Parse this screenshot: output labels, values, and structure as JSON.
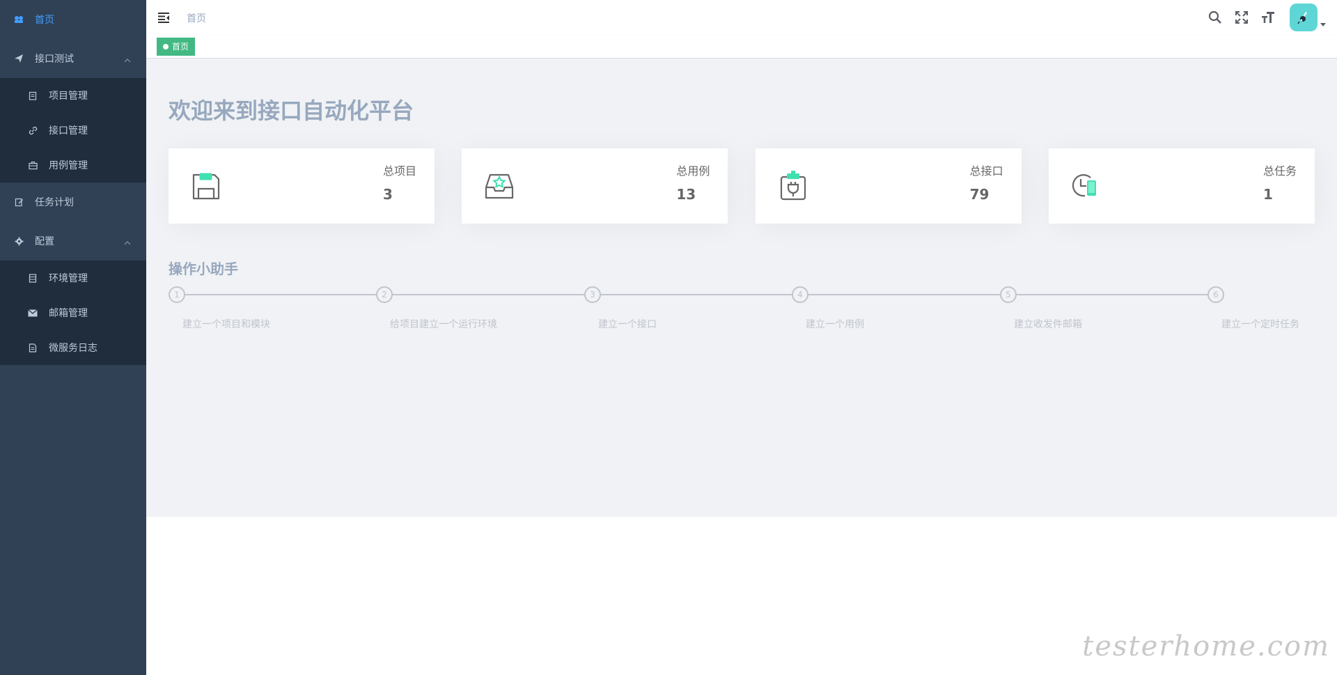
{
  "sidebar": {
    "items": [
      {
        "label": "首页",
        "icon": "dashboard-icon",
        "active": true
      },
      {
        "label": "接口测试",
        "icon": "send-icon",
        "expanded": true,
        "children": [
          {
            "label": "项目管理",
            "icon": "clipboard-icon"
          },
          {
            "label": "接口管理",
            "icon": "link-icon"
          },
          {
            "label": "用例管理",
            "icon": "briefcase-icon"
          }
        ]
      },
      {
        "label": "任务计划",
        "icon": "edit-icon"
      },
      {
        "label": "配置",
        "icon": "gear-icon",
        "expanded": true,
        "children": [
          {
            "label": "环境管理",
            "icon": "list-icon"
          },
          {
            "label": "邮箱管理",
            "icon": "envelope-icon"
          },
          {
            "label": "微服务日志",
            "icon": "document-icon"
          }
        ]
      }
    ]
  },
  "navbar": {
    "breadcrumb": "首页",
    "icons": [
      "search-icon",
      "fullscreen-icon",
      "font-size-icon"
    ],
    "avatar_color": "#5fd6d6"
  },
  "tags_view": {
    "active_tag": "首页",
    "active_color": "#42b983"
  },
  "main": {
    "welcome": "欢迎来到接口自动化平台",
    "cards": [
      {
        "label": "总项目",
        "value": "3",
        "icon": "save-disk-icon"
      },
      {
        "label": "总用例",
        "value": "13",
        "icon": "inbox-star-icon"
      },
      {
        "label": "总接口",
        "value": "79",
        "icon": "plug-icon"
      },
      {
        "label": "总任务",
        "value": "1",
        "icon": "clock-phone-icon"
      }
    ],
    "helper_title": "操作小助手",
    "steps": [
      {
        "number": "1",
        "title": "建立一个项目和模块"
      },
      {
        "number": "2",
        "title": "给项目建立一个运行环境"
      },
      {
        "number": "3",
        "title": "建立一个接口"
      },
      {
        "number": "4",
        "title": "建立一个用例"
      },
      {
        "number": "5",
        "title": "建立收发件邮箱"
      },
      {
        "number": "6",
        "title": "建立一个定时任务"
      }
    ]
  },
  "watermark": "testerhome.com"
}
